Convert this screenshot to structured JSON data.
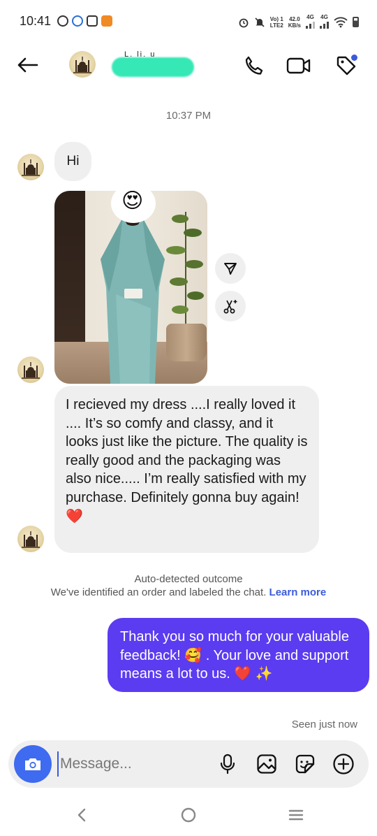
{
  "status_bar": {
    "time": "10:41",
    "network_line1": "Vo) 1",
    "network_line2": "LTE2",
    "speed_line1": "42.0",
    "speed_line2": "KB/s",
    "signal1_label": "4G",
    "signal2_label": "4G"
  },
  "header": {
    "contact_name_partial": "L. li. u"
  },
  "chat": {
    "timestamp": "10:37 PM",
    "messages": [
      {
        "from": "contact",
        "type": "text",
        "text": "Hi"
      },
      {
        "from": "contact",
        "type": "image",
        "overlay_emoji": "😍"
      },
      {
        "from": "contact",
        "type": "text",
        "text": "I recieved my dress ....I really loved  it .... It’s so comfy and classy, and it looks just like the picture. The quality is really good and the packaging was also nice..... I’m really satisfied with my purchase.  Definitely gonna buy again! ❤️"
      },
      {
        "from": "me",
        "type": "text",
        "text": "Thank you so much for your valuable feedback! 🥰 . Your love and support means a lot to us. ❤️ ✨"
      }
    ],
    "auto_detect_title": "Auto-detected outcome",
    "auto_detect_body": "We've identified an order and labeled the chat.",
    "learn_more": "Learn more",
    "seen_status": "Seen just now"
  },
  "composer": {
    "placeholder": "Message..."
  },
  "icons": {
    "back": "arrow-left-icon",
    "call": "phone-icon",
    "video": "video-camera-icon",
    "tag": "tag-icon",
    "share": "send-icon",
    "remix": "remix-icon",
    "camera": "camera-icon",
    "mic": "microphone-icon",
    "gallery": "image-icon",
    "sticker": "sticker-icon",
    "plus": "plus-circle-icon"
  },
  "colors": {
    "outgoing_bubble": "#5b3cf0",
    "incoming_bubble": "#efefef",
    "accent": "#3b5bdb",
    "camera_button": "#3e6bf0"
  }
}
